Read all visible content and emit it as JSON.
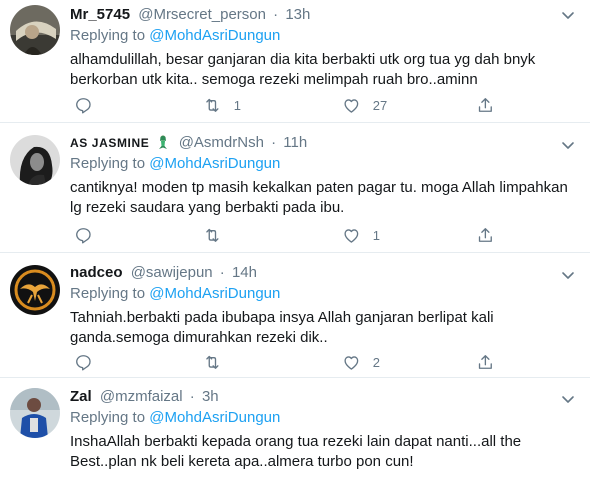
{
  "reply_prefix": "Replying to",
  "tweets": [
    {
      "name": "Mr_5745",
      "handle": "@Mrsecret_person",
      "separator": "·",
      "time": "13h",
      "reply_to": "@MohdAsriDungun",
      "text_lines": [
        "alhamdulillah, besar ganjaran dia kita berbakti utk org tua yg dah bnyk",
        "berkorban utk kita.. semoga rezeki melimpah ruah bro..aminn"
      ],
      "retweets": "1",
      "likes": "27"
    },
    {
      "name": "AS JASMINE",
      "name_emoji": "mermaid-emoji",
      "handle": "@AsmdrNsh",
      "separator": "·",
      "time": "11h",
      "reply_to": "@MohdAsriDungun",
      "text_lines": [
        "cantiknya! moden tp masih kekalkan paten pagar tu. moga Allah limpahkan",
        "lg rezeki saudara yang berbakti pada ibu."
      ],
      "retweets": "",
      "likes": "1"
    },
    {
      "name": "nadceo",
      "handle": "@sawijepun",
      "separator": "·",
      "time": "14h",
      "reply_to": "@MohdAsriDungun",
      "text_lines": [
        "Tahniah.berbakti pada ibubapa insya Allah ganjaran berlipat kali",
        "ganda.semoga dimurahkan rezeki dik.."
      ],
      "retweets": "",
      "likes": "2"
    },
    {
      "name": "Zal",
      "handle": "@mzmfaizal",
      "separator": "·",
      "time": "3h",
      "reply_to": "@MohdAsriDungun",
      "text_lines": [
        "InshaAllah berbakti kepada orang tua rezeki lain dapat nanti...all the",
        "Best..plan nk beli kereta apa..almera turbo pon cun!"
      ]
    }
  ],
  "icons": {
    "reply": "reply-icon",
    "retweet": "retweet-icon",
    "like": "like-icon",
    "share": "share-icon",
    "more": "chevron-down-icon"
  },
  "colors": {
    "text": "#14171a",
    "secondary": "#657786",
    "mention": "#1da1f2",
    "divider": "#e6ecf0"
  }
}
